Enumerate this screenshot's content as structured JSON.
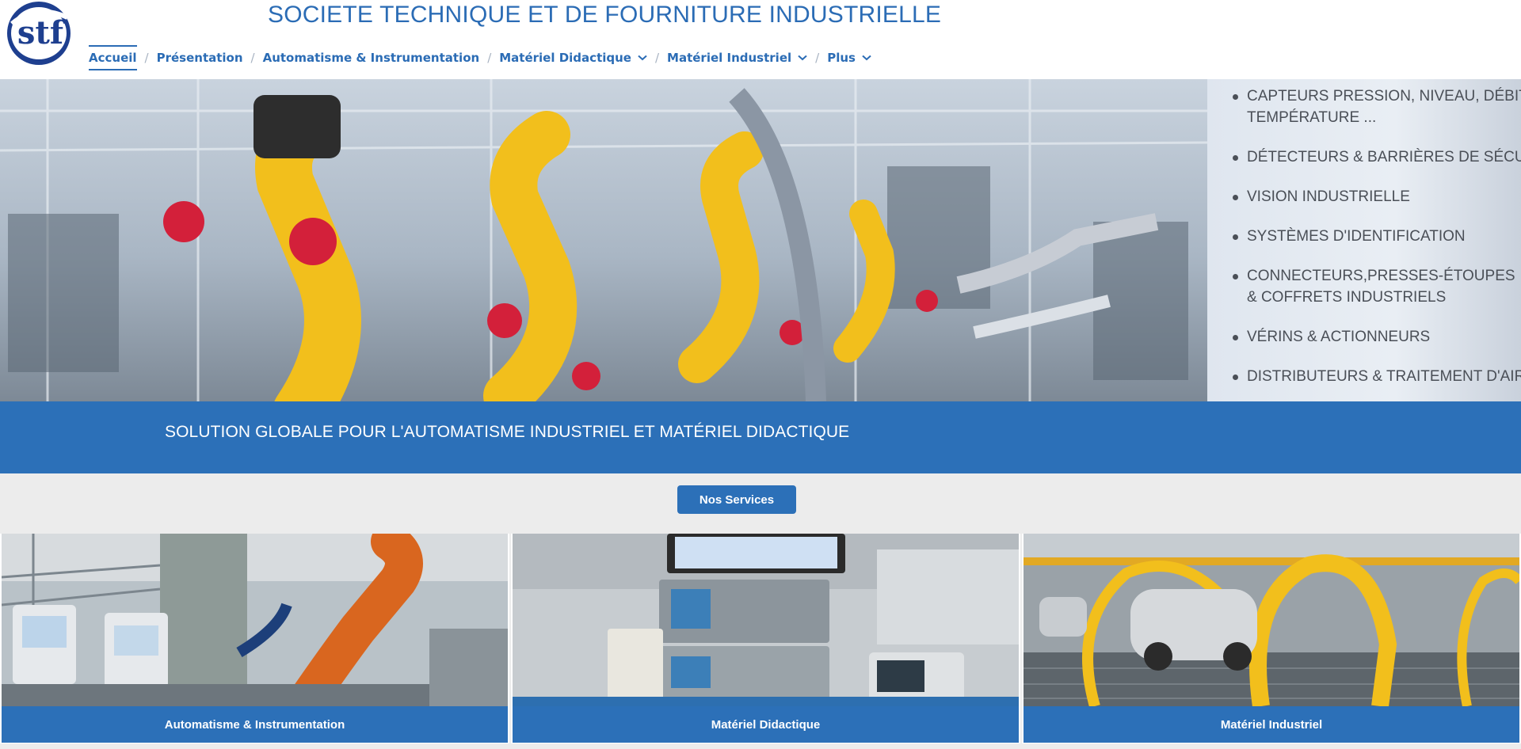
{
  "header": {
    "logo_text": "stf",
    "title": "SOCIETE TECHNIQUE ET DE FOURNITURE INDUSTRIELLE"
  },
  "nav": {
    "items": [
      {
        "label": "Accueil",
        "active": true,
        "dropdown": false
      },
      {
        "label": "Présentation",
        "active": false,
        "dropdown": false
      },
      {
        "label": "Automatisme & Instrumentation",
        "active": false,
        "dropdown": false
      },
      {
        "label": "Matériel Didactique",
        "active": false,
        "dropdown": true
      },
      {
        "label": "Matériel Industriel",
        "active": false,
        "dropdown": true
      },
      {
        "label": "Plus",
        "active": false,
        "dropdown": true
      }
    ],
    "separator": "/"
  },
  "hero": {
    "list": [
      "CAPTEURS PRESSION, NIVEAU, DÉBIT",
      "TEMPÉRATURE ...",
      "DÉTECTEURS & BARRIÈRES DE SÉCURITÉ",
      "VISION INDUSTRIELLE",
      "SYSTÈMES D'IDENTIFICATION",
      "CONNECTEURS,PRESSES-ÉTOUPES",
      "& COFFRETS INDUSTRIELS",
      "VÉRINS & ACTIONNEURS",
      "DISTRIBUTEURS & TRAITEMENT D'AIR"
    ]
  },
  "band": {
    "text": "SOLUTION GLOBALE POUR L'AUTOMATISME INDUSTRIEL ET MATÉRIEL DIDACTIQUE"
  },
  "services_button": "Nos Services",
  "cards": [
    {
      "label": "Automatisme & Instrumentation"
    },
    {
      "label": "Matériel Didactique"
    },
    {
      "label": "Matériel Industriel"
    }
  ],
  "colors": {
    "brand_blue": "#2c70b8",
    "robot_yellow": "#f2bf1c",
    "robot_orange": "#d9661f",
    "page_bg": "#ececec"
  }
}
